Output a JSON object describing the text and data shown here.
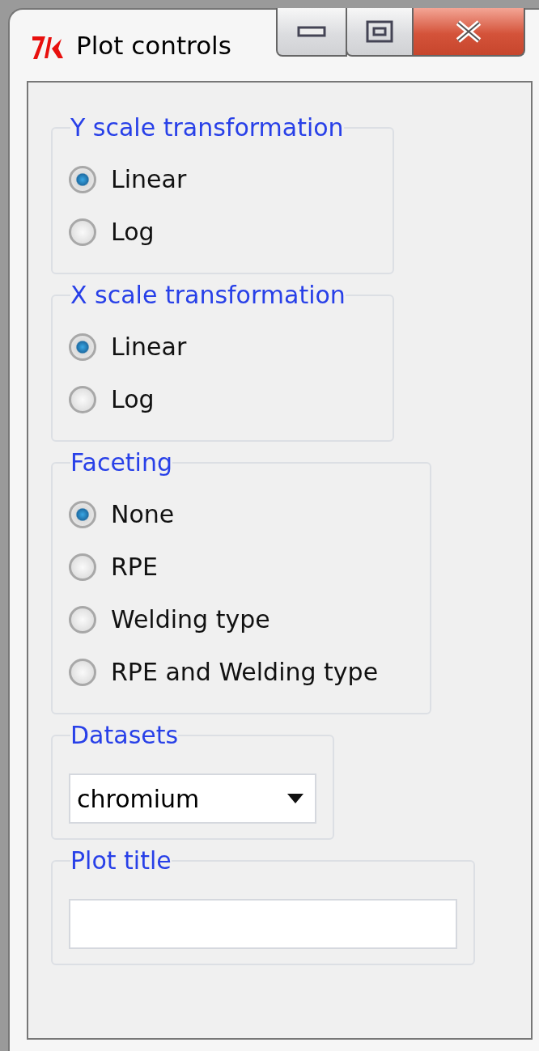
{
  "window": {
    "title": "Plot controls"
  },
  "groups": [
    {
      "kind": "radio",
      "title": "Y scale transformation",
      "options": [
        {
          "label": "Linear",
          "selected": true
        },
        {
          "label": "Log",
          "selected": false
        }
      ]
    },
    {
      "kind": "radio",
      "title": "X scale transformation",
      "options": [
        {
          "label": "Linear",
          "selected": true
        },
        {
          "label": "Log",
          "selected": false
        }
      ]
    },
    {
      "kind": "radio",
      "title": "Faceting",
      "options": [
        {
          "label": "None",
          "selected": true
        },
        {
          "label": "RPE",
          "selected": false
        },
        {
          "label": "Welding type",
          "selected": false
        },
        {
          "label": "RPE and Welding type",
          "selected": false
        }
      ]
    },
    {
      "kind": "dropdown",
      "title": "Datasets",
      "value": "chromium"
    },
    {
      "kind": "entry",
      "title": "Plot title"
    }
  ]
}
